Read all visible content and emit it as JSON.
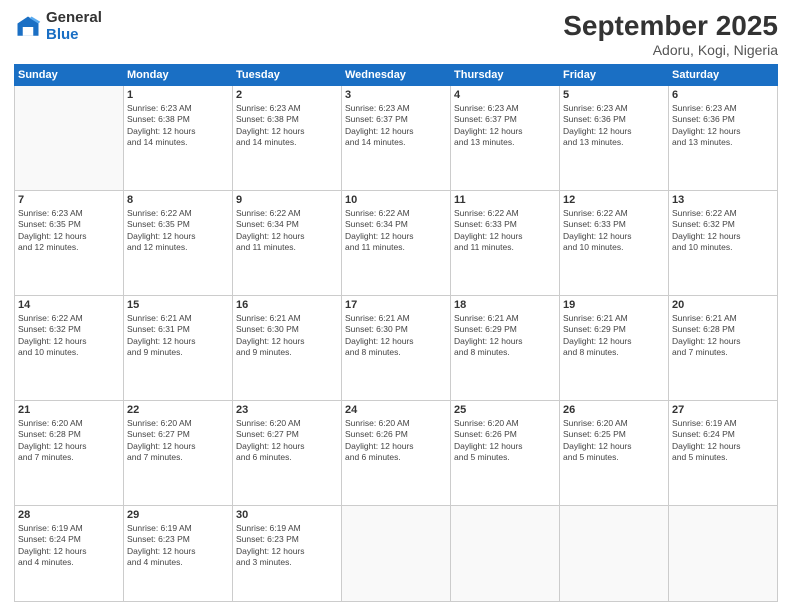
{
  "logo": {
    "general": "General",
    "blue": "Blue"
  },
  "title": "September 2025",
  "location": "Adoru, Kogi, Nigeria",
  "days_header": [
    "Sunday",
    "Monday",
    "Tuesday",
    "Wednesday",
    "Thursday",
    "Friday",
    "Saturday"
  ],
  "weeks": [
    [
      {
        "num": "",
        "info": ""
      },
      {
        "num": "1",
        "info": "Sunrise: 6:23 AM\nSunset: 6:38 PM\nDaylight: 12 hours\nand 14 minutes."
      },
      {
        "num": "2",
        "info": "Sunrise: 6:23 AM\nSunset: 6:38 PM\nDaylight: 12 hours\nand 14 minutes."
      },
      {
        "num": "3",
        "info": "Sunrise: 6:23 AM\nSunset: 6:37 PM\nDaylight: 12 hours\nand 14 minutes."
      },
      {
        "num": "4",
        "info": "Sunrise: 6:23 AM\nSunset: 6:37 PM\nDaylight: 12 hours\nand 13 minutes."
      },
      {
        "num": "5",
        "info": "Sunrise: 6:23 AM\nSunset: 6:36 PM\nDaylight: 12 hours\nand 13 minutes."
      },
      {
        "num": "6",
        "info": "Sunrise: 6:23 AM\nSunset: 6:36 PM\nDaylight: 12 hours\nand 13 minutes."
      }
    ],
    [
      {
        "num": "7",
        "info": "Sunrise: 6:23 AM\nSunset: 6:35 PM\nDaylight: 12 hours\nand 12 minutes."
      },
      {
        "num": "8",
        "info": "Sunrise: 6:22 AM\nSunset: 6:35 PM\nDaylight: 12 hours\nand 12 minutes."
      },
      {
        "num": "9",
        "info": "Sunrise: 6:22 AM\nSunset: 6:34 PM\nDaylight: 12 hours\nand 11 minutes."
      },
      {
        "num": "10",
        "info": "Sunrise: 6:22 AM\nSunset: 6:34 PM\nDaylight: 12 hours\nand 11 minutes."
      },
      {
        "num": "11",
        "info": "Sunrise: 6:22 AM\nSunset: 6:33 PM\nDaylight: 12 hours\nand 11 minutes."
      },
      {
        "num": "12",
        "info": "Sunrise: 6:22 AM\nSunset: 6:33 PM\nDaylight: 12 hours\nand 10 minutes."
      },
      {
        "num": "13",
        "info": "Sunrise: 6:22 AM\nSunset: 6:32 PM\nDaylight: 12 hours\nand 10 minutes."
      }
    ],
    [
      {
        "num": "14",
        "info": "Sunrise: 6:22 AM\nSunset: 6:32 PM\nDaylight: 12 hours\nand 10 minutes."
      },
      {
        "num": "15",
        "info": "Sunrise: 6:21 AM\nSunset: 6:31 PM\nDaylight: 12 hours\nand 9 minutes."
      },
      {
        "num": "16",
        "info": "Sunrise: 6:21 AM\nSunset: 6:30 PM\nDaylight: 12 hours\nand 9 minutes."
      },
      {
        "num": "17",
        "info": "Sunrise: 6:21 AM\nSunset: 6:30 PM\nDaylight: 12 hours\nand 8 minutes."
      },
      {
        "num": "18",
        "info": "Sunrise: 6:21 AM\nSunset: 6:29 PM\nDaylight: 12 hours\nand 8 minutes."
      },
      {
        "num": "19",
        "info": "Sunrise: 6:21 AM\nSunset: 6:29 PM\nDaylight: 12 hours\nand 8 minutes."
      },
      {
        "num": "20",
        "info": "Sunrise: 6:21 AM\nSunset: 6:28 PM\nDaylight: 12 hours\nand 7 minutes."
      }
    ],
    [
      {
        "num": "21",
        "info": "Sunrise: 6:20 AM\nSunset: 6:28 PM\nDaylight: 12 hours\nand 7 minutes."
      },
      {
        "num": "22",
        "info": "Sunrise: 6:20 AM\nSunset: 6:27 PM\nDaylight: 12 hours\nand 7 minutes."
      },
      {
        "num": "23",
        "info": "Sunrise: 6:20 AM\nSunset: 6:27 PM\nDaylight: 12 hours\nand 6 minutes."
      },
      {
        "num": "24",
        "info": "Sunrise: 6:20 AM\nSunset: 6:26 PM\nDaylight: 12 hours\nand 6 minutes."
      },
      {
        "num": "25",
        "info": "Sunrise: 6:20 AM\nSunset: 6:26 PM\nDaylight: 12 hours\nand 5 minutes."
      },
      {
        "num": "26",
        "info": "Sunrise: 6:20 AM\nSunset: 6:25 PM\nDaylight: 12 hours\nand 5 minutes."
      },
      {
        "num": "27",
        "info": "Sunrise: 6:19 AM\nSunset: 6:24 PM\nDaylight: 12 hours\nand 5 minutes."
      }
    ],
    [
      {
        "num": "28",
        "info": "Sunrise: 6:19 AM\nSunset: 6:24 PM\nDaylight: 12 hours\nand 4 minutes."
      },
      {
        "num": "29",
        "info": "Sunrise: 6:19 AM\nSunset: 6:23 PM\nDaylight: 12 hours\nand 4 minutes."
      },
      {
        "num": "30",
        "info": "Sunrise: 6:19 AM\nSunset: 6:23 PM\nDaylight: 12 hours\nand 3 minutes."
      },
      {
        "num": "",
        "info": ""
      },
      {
        "num": "",
        "info": ""
      },
      {
        "num": "",
        "info": ""
      },
      {
        "num": "",
        "info": ""
      }
    ]
  ]
}
